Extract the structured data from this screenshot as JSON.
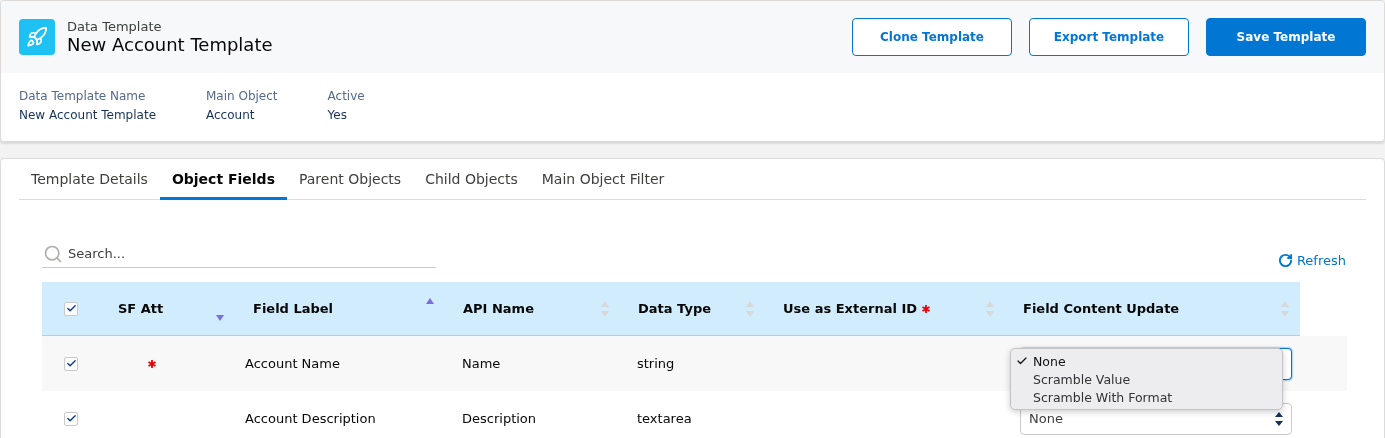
{
  "header": {
    "subtitle": "Data Template",
    "title": "New Account Template",
    "buttons": [
      {
        "label": "Clone Template",
        "kind": "outline"
      },
      {
        "label": "Export Template",
        "kind": "outline"
      },
      {
        "label": "Save Template",
        "kind": "primary"
      }
    ]
  },
  "details": [
    {
      "label": "Data Template Name",
      "value": "New Account Template"
    },
    {
      "label": "Main Object",
      "value": "Account"
    },
    {
      "label": "Active",
      "value": "Yes"
    }
  ],
  "tabs": [
    {
      "label": "Template Details",
      "selected": false
    },
    {
      "label": "Object Fields",
      "selected": true
    },
    {
      "label": "Parent Objects",
      "selected": false
    },
    {
      "label": "Child Objects",
      "selected": false
    },
    {
      "label": "Main Object Filter",
      "selected": false
    }
  ],
  "search": {
    "placeholder": "Search..."
  },
  "refresh": {
    "label": "Refresh"
  },
  "table": {
    "select_all_checked": true,
    "columns": [
      {
        "label": "SF Att",
        "sorted_asc": false,
        "sorted_desc": true,
        "required": false
      },
      {
        "label": "Field Label",
        "sorted_asc": true,
        "sorted_desc": false,
        "required": false
      },
      {
        "label": "API Name",
        "sorted_asc": false,
        "sorted_desc": false,
        "required": false
      },
      {
        "label": "Data Type",
        "sorted_asc": false,
        "sorted_desc": false,
        "required": false
      },
      {
        "label": "Use as External ID",
        "sorted_asc": false,
        "sorted_desc": false,
        "required": true
      },
      {
        "label": "Field Content Update",
        "sorted_asc": false,
        "sorted_desc": false,
        "required": false
      }
    ],
    "rows": [
      {
        "checked": true,
        "required": true,
        "field_label": "Account Name",
        "api_name": "Name",
        "data_type": "string",
        "update": {
          "focused": true,
          "menu": [
            {
              "label": "None",
              "selected": true
            },
            {
              "label": "Scramble Value",
              "selected": false
            },
            {
              "label": "Scramble With Format",
              "selected": false
            }
          ]
        }
      },
      {
        "checked": true,
        "required": false,
        "field_label": "Account Description",
        "api_name": "Description",
        "data_type": "textarea",
        "update": {
          "focused": false,
          "value": "None"
        }
      }
    ]
  }
}
